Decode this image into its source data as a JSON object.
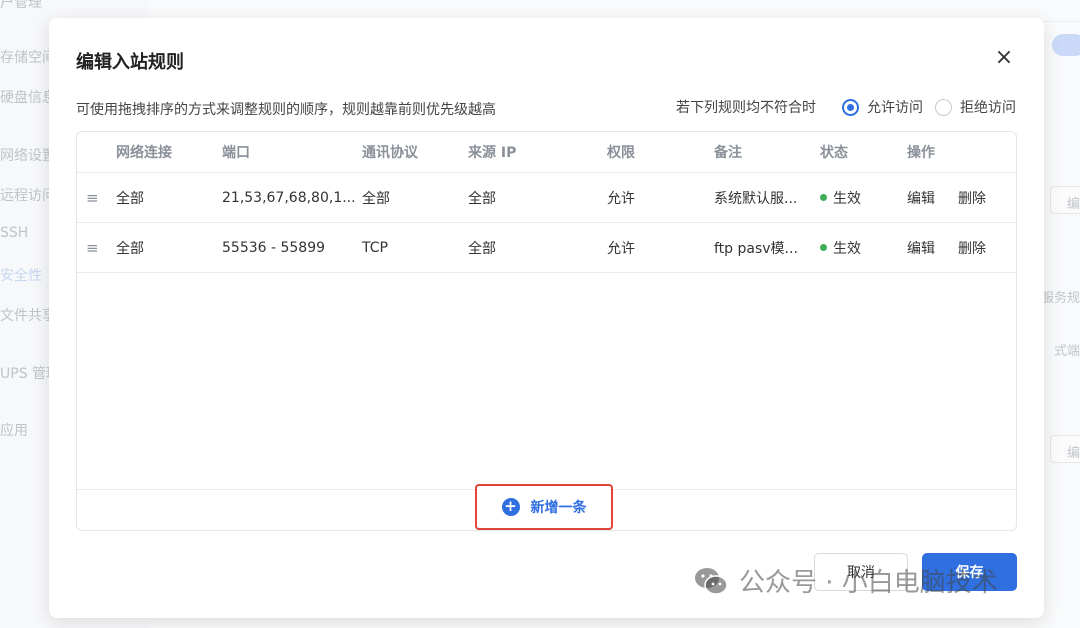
{
  "background": {
    "sidebar_items": [
      "户管理",
      "存储空间",
      "硬盘信息",
      "网络设置",
      "远程访问",
      "SSH",
      "安全性",
      "文件共享",
      "UPS 管理",
      "应用"
    ],
    "right_texts": [
      "编",
      "服务规",
      "式端",
      "编"
    ]
  },
  "dialog": {
    "title": "编辑入站规则",
    "close": "×",
    "hint": "可使用拖拽排序的方式来调整规则的顺序，规则越靠前则优先级越高",
    "default_policy": {
      "label": "若下列规则均不符合时",
      "options": [
        {
          "label": "允许访问",
          "checked": true
        },
        {
          "label": "拒绝访问",
          "checked": false
        }
      ]
    },
    "table": {
      "columns": [
        "网络连接",
        "端口",
        "通讯协议",
        "来源 IP",
        "权限",
        "备注",
        "状态",
        "操作"
      ],
      "rows": [
        {
          "drag": "≡",
          "net": "全部",
          "port": "21,53,67,68,80,1...",
          "proto": "全部",
          "src": "全部",
          "perm": "允许",
          "note": "系统默认服...",
          "status": "生效",
          "edit": "编辑",
          "delete": "删除"
        },
        {
          "drag": "≡",
          "net": "全部",
          "port": "55536 - 55899",
          "proto": "TCP",
          "src": "全部",
          "perm": "允许",
          "note": "ftp pasv模...",
          "status": "生效",
          "edit": "编辑",
          "delete": "删除"
        }
      ],
      "add_label": "新增一条"
    },
    "cancel_label": "取消",
    "save_label": "保存"
  },
  "watermark": "公众号 · 小白电脑技术",
  "colors": {
    "accent": "#2f6fe0",
    "highlight": "#e0443a",
    "status_ok": "#3dae5a"
  }
}
